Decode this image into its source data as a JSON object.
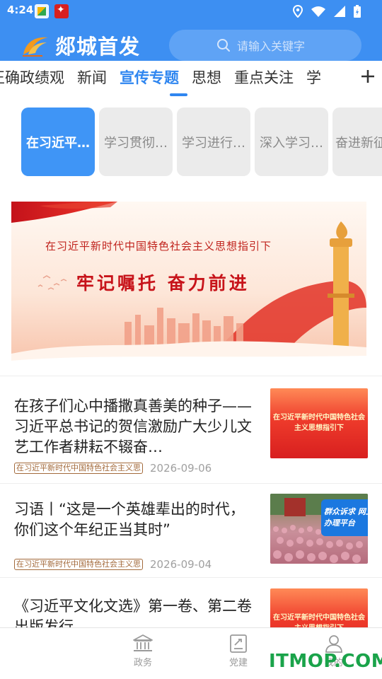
{
  "status_bar": {
    "time": "4:24",
    "icons": [
      "app-icon",
      "news-app-icon",
      "location-icon",
      "wifi-icon",
      "signal-icon",
      "battery-icon"
    ]
  },
  "header": {
    "app_name": "郯城首发",
    "search_placeholder": "请输入关键字",
    "brand_color": "#3d8ff2"
  },
  "tabs": {
    "items": [
      {
        "label": "正确政绩观"
      },
      {
        "label": "新闻"
      },
      {
        "label": "宣传专题"
      },
      {
        "label": "思想"
      },
      {
        "label": "重点关注"
      },
      {
        "label": "学"
      }
    ],
    "active_index": 2,
    "more_icon": "plus-icon"
  },
  "chips": [
    {
      "label": "在习近平…",
      "active": true
    },
    {
      "label": "学习贯彻…",
      "active": false
    },
    {
      "label": "学习进行…",
      "active": false
    },
    {
      "label": "深入学习…",
      "active": false
    },
    {
      "label": "奋进新征",
      "active": false
    }
  ],
  "banner": {
    "headline": "在习近平新时代中国特色社会主义思想指引下",
    "slogan": "牢记嘱托 奋力前进"
  },
  "news": [
    {
      "title": "在孩子们心中播撒真善美的种子——习近平总书记的贺信激励广大少儿文艺工作者耕耘不辍奋…",
      "tag": "在习近平新时代中国特色社会主义思",
      "date": "2026-09-06",
      "thumb_text": "在习近平新时代中国特色社会主义思想指引下"
    },
    {
      "title": "习语丨“这是一个英雄辈出的时代，你们这个年纪正当其时”",
      "tag": "在习近平新时代中国特色社会主义思",
      "date": "2026-09-04",
      "thumb_text": "群众诉求 网上办理平台"
    },
    {
      "title": "《习近平文化文选》第一卷、第二卷出版发行",
      "thumb_text": "在习近平新时代中国特色社会主义思想指引下"
    }
  ],
  "bottom_nav": {
    "items": [
      {
        "label": "政务",
        "icon": "government-building-icon"
      },
      {
        "label": "党建",
        "icon": "party-building-icon"
      },
      {
        "label": "我的",
        "icon": "user-icon"
      }
    ]
  },
  "watermark": "ITMOP.COM"
}
